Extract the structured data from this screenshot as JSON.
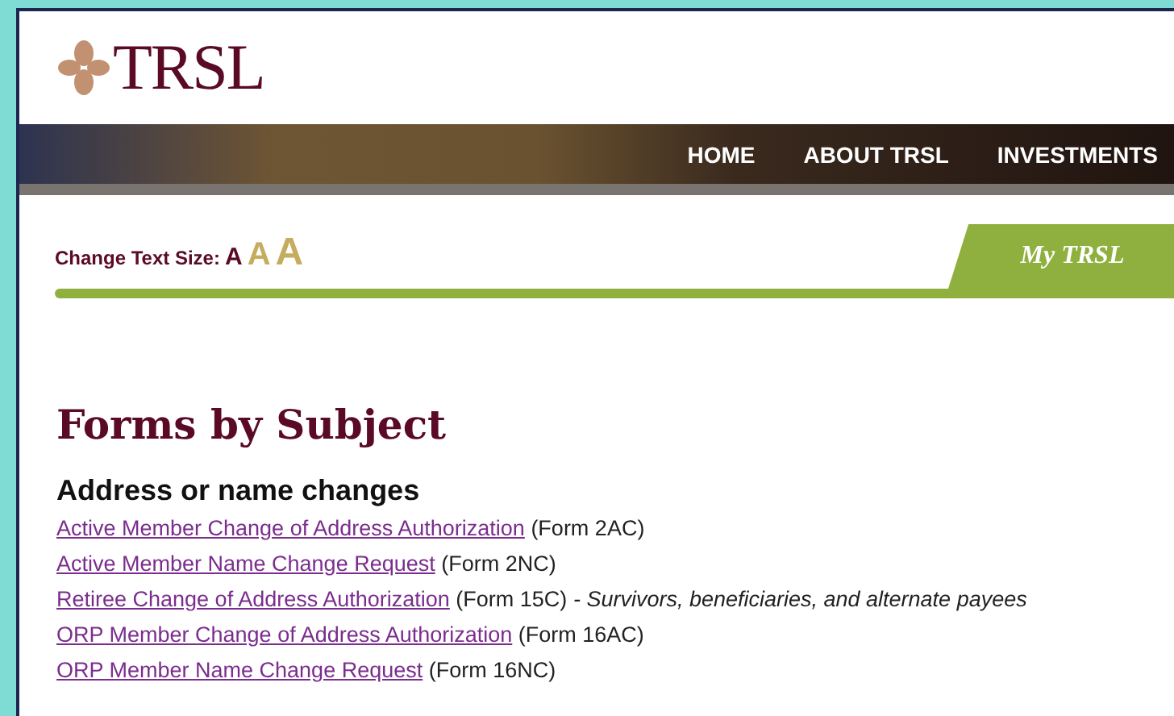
{
  "logo": {
    "text": "TRSL"
  },
  "nav": {
    "items": [
      "HOME",
      "ABOUT TRSL",
      "INVESTMENTS"
    ]
  },
  "text_size": {
    "label": "Change Text Size:",
    "options": [
      {
        "label": "A",
        "selected": true
      },
      {
        "label": "A",
        "selected": false
      },
      {
        "label": "A",
        "selected": false
      }
    ]
  },
  "my_trsl_tab": {
    "label": "My TRSL"
  },
  "page_title": "Forms by Subject",
  "sections": [
    {
      "heading": "Address or name changes",
      "forms": [
        {
          "link": "Active Member Change of Address Authorization",
          "form": "(Form 2AC)"
        },
        {
          "link": "Active Member Name Change Request",
          "form": "(Form 2NC)"
        },
        {
          "link": "Retiree Change of Address Authorization",
          "form": "(Form 15C)",
          "note": "- Survivors, beneficiaries, and alternate payees"
        },
        {
          "link": "ORP Member Change of Address Authorization",
          "form": "(Form 16AC)"
        },
        {
          "link": "ORP Member Name Change Request",
          "form": "(Form 16NC)"
        }
      ]
    }
  ]
}
